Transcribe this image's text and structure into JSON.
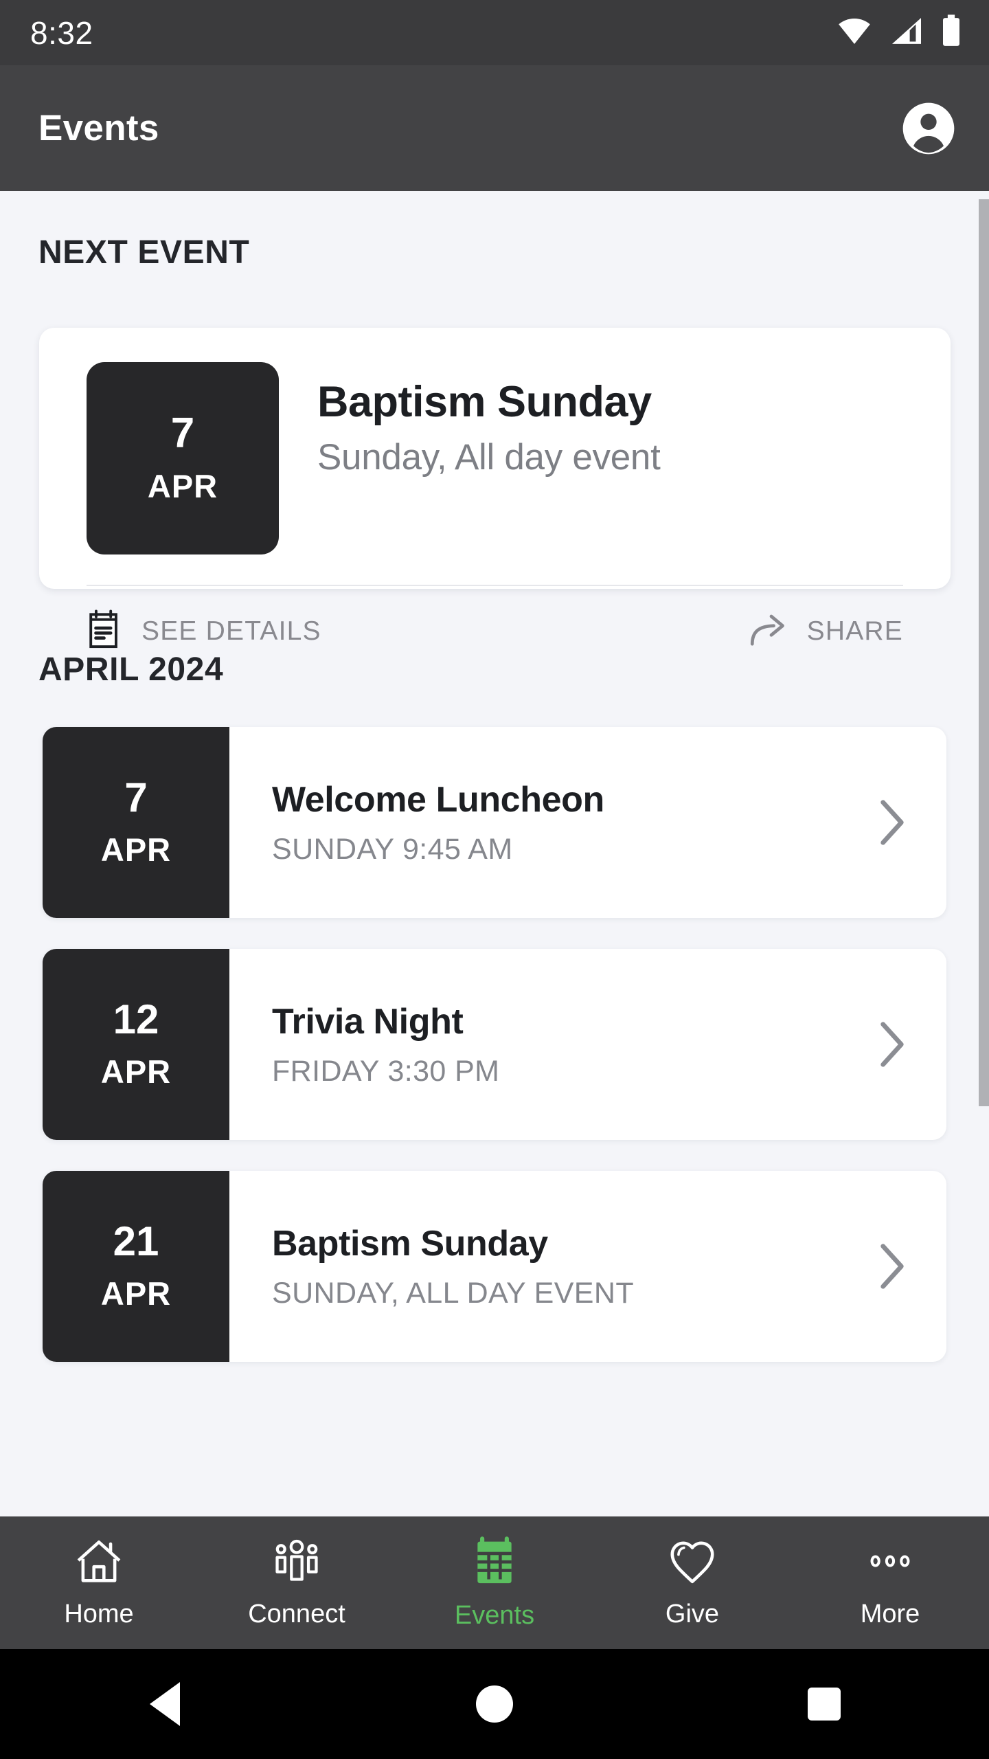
{
  "status_bar": {
    "time": "8:32",
    "icons": [
      "wifi-icon",
      "cellular-signal-icon",
      "battery-icon"
    ]
  },
  "app_bar": {
    "title": "Events",
    "account_icon": "account-circle-icon"
  },
  "next_event_section": {
    "heading": "NEXT EVENT",
    "card": {
      "day": "7",
      "month": "APR",
      "title": "Baptism Sunday",
      "subtitle": "Sunday, All day event",
      "see_details_label": "SEE DETAILS",
      "see_details_icon": "event-note-icon",
      "share_label": "SHARE",
      "share_icon": "share-arrow-icon"
    }
  },
  "month_section": {
    "heading": "APRIL 2024",
    "events": [
      {
        "day": "7",
        "month": "APR",
        "title": "Welcome Luncheon",
        "subtitle": "SUNDAY 9:45 AM",
        "chevron": "chevron-right-icon"
      },
      {
        "day": "12",
        "month": "APR",
        "title": "Trivia Night",
        "subtitle": "FRIDAY 3:30 PM",
        "chevron": "chevron-right-icon"
      },
      {
        "day": "21",
        "month": "APR",
        "title": "Baptism Sunday",
        "subtitle": "SUNDAY, ALL DAY EVENT",
        "chevron": "chevron-right-icon"
      }
    ]
  },
  "bottom_nav": {
    "active": "Events",
    "items": [
      {
        "label": "Home",
        "icon": "home-icon",
        "active": false
      },
      {
        "label": "Connect",
        "icon": "people-icon",
        "active": false
      },
      {
        "label": "Events",
        "icon": "calendar-icon",
        "active": true
      },
      {
        "label": "Give",
        "icon": "heart-icon",
        "active": false
      },
      {
        "label": "More",
        "icon": "more-dots-icon",
        "active": false
      }
    ]
  },
  "android_nav": {
    "back": "back-triangle-icon",
    "home": "home-circle-icon",
    "recents": "recents-square-icon"
  },
  "colors": {
    "accent_green": "#5bbf5f",
    "badge_dark": "#272729",
    "app_bar": "#434345",
    "status_bar": "#3b3b3d",
    "page_background": "#f4f5f9",
    "card_white": "#ffffff",
    "muted_text": "#85878d"
  }
}
